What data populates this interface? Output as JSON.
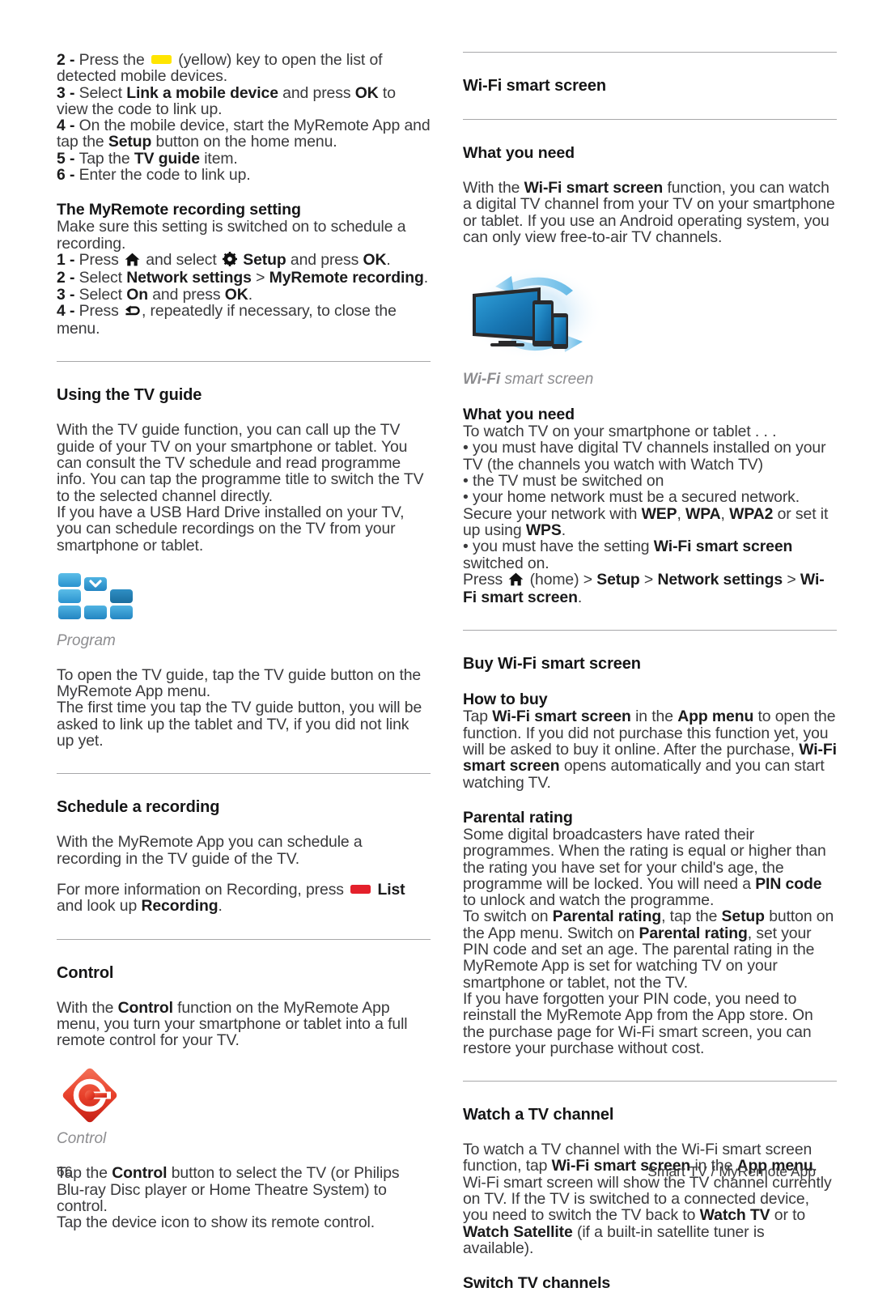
{
  "page": {
    "number": "66",
    "footer_title": "Smart TV / MyRemote App"
  },
  "left_column": {
    "steps_link": [
      {
        "num": "2 -",
        "text_before": "Press the",
        "key": "yellow-key",
        "text_after": "(yellow) key to open the list of detected mobile devices."
      },
      {
        "num": "3 -",
        "text": "Select Link a mobile device and press OK to view the code to link up."
      },
      {
        "num": "4 -",
        "text": "On the mobile device, start the MyRemote App and tap the Setup button on the home menu."
      },
      {
        "num": "5 -",
        "text": "Tap the TV guide item."
      },
      {
        "num": "6 -",
        "text": "Enter the code to link up."
      }
    ],
    "step2_parts": {
      "lead": "Press the",
      "tail": "(yellow) key to open the list of detected mobile devices."
    },
    "step3_parts": {
      "a": "Select ",
      "b1": "Link a mobile device",
      "c": " and press ",
      "b2": "OK",
      "d": " to view the code to link up."
    },
    "step4_parts": {
      "a": "On the mobile device, start the MyRemote App and tap the ",
      "b1": "Setup",
      "c": " button on the home menu."
    },
    "step5_parts": {
      "a": "Tap the ",
      "b1": "TV guide",
      "c": " item."
    },
    "step6_parts": {
      "a": "Enter the code to link up."
    },
    "recording_setting": {
      "heading": "The MyRemote recording setting",
      "intro": "Make sure this setting is switched on to schedule a recording.",
      "step1": {
        "num": "1 -",
        "a": "Press ",
        "icon1": "home-icon",
        "b": " and select ",
        "icon2": "gear-icon",
        "c": " ",
        "bold": "Setup",
        "d": " and press ",
        "bold2": "OK",
        "e": "."
      },
      "step2": {
        "num": "2 -",
        "a": "Select ",
        "b1": "Network settings",
        "c": " > ",
        "b2": "MyRemote recording",
        "d": "."
      },
      "step3": {
        "num": "3 -",
        "a": "Select ",
        "b1": "On",
        "c": " and press ",
        "b2": "OK",
        "d": "."
      },
      "step4": {
        "num": "4 -",
        "a": "Press ",
        "icon": "back-arrow-icon",
        "b": ", repeatedly if necessary, to close the menu."
      }
    },
    "tv_guide": {
      "title": "Using the TV guide",
      "para1": "With the TV guide function, you can call up the TV guide of your TV on your smartphone or tablet. You can consult the TV schedule and read programme info. You can tap the programme title to switch the TV to the selected channel directly.",
      "para2": "If you have a USB Hard Drive installed on your TV, you can schedule recordings on the TV from your smartphone or tablet.",
      "figure_caption": "Program",
      "para3": "To open the TV guide, tap the TV guide button on the MyRemote App menu.",
      "para4": "The first time you tap the TV guide button, you will be asked to link up the tablet and TV, if you did not link up yet."
    },
    "schedule_recording": {
      "title": "Schedule a recording",
      "para1": "With the MyRemote App you can schedule a recording in the TV guide of the TV.",
      "para2_a": "For more information on Recording, press ",
      "para2_key": "red-key",
      "para2_b": "List",
      "para2_c": " and look up ",
      "para2_d": "Recording",
      "para2_e": "."
    },
    "control": {
      "title": "Control",
      "para1_a": "With the ",
      "para1_b": "Control",
      "para1_c": " function on the MyRemote App menu, you turn your smartphone or tablet into a full remote control for your TV.",
      "figure_caption": "Control",
      "para2_a": "Tap the ",
      "para2_b": "Control",
      "para2_c": " button to select the TV (or Philips Blu-ray Disc player or Home Theatre System) to control.",
      "para3": "Tap the device icon to show its remote control."
    }
  },
  "right_column": {
    "wifi_smart_screen": {
      "title": "Wi-Fi smart screen",
      "heading1": "What you need",
      "para1_a": "With the ",
      "para1_b": "Wi-Fi smart screen",
      "para1_c": " function, you can watch a digital TV channel from your TV on your smartphone or tablet. If you use an Android operating system, you can only view free-to-air TV channels.",
      "figure_caption_bold": "Wi-Fi",
      "figure_caption_rest": " smart screen",
      "heading2": "What you need",
      "lead": "To watch TV on your smartphone or tablet . . .",
      "bullets": [
        {
          "text": "you must have digital TV channels installed on your TV (the channels you watch with Watch TV)"
        },
        {
          "text": "the TV must be switched on"
        },
        {
          "text": "your home network must be a secured network. Secure your network with WEP, WPA, WPA2 or set it up using WPS."
        },
        {
          "text": "you must have the setting Wi-Fi smart screen switched on."
        }
      ],
      "bullet3_parts": {
        "a": "your home network must be a secured network. Secure your network with ",
        "b1": "WEP",
        "c": ", ",
        "b2": "WPA",
        "d": ", ",
        "b3": "WPA2",
        "e": " or set it up using ",
        "b4": "WPS",
        "f": "."
      },
      "bullet4_parts": {
        "a": "you must have the setting ",
        "b1": "Wi-Fi smart screen",
        "c": " switched on."
      },
      "press_path": {
        "a": "Press ",
        "icon": "home-icon",
        "b": " (home) > ",
        "b1": "Setup",
        "c": " > ",
        "b2": "Network settings",
        "d": " > ",
        "b3": "Wi-Fi smart screen",
        "e": "."
      }
    },
    "buy": {
      "title": "Buy Wi-Fi smart screen",
      "heading": "How to buy",
      "para_a": "Tap ",
      "para_b1": "Wi-Fi smart screen",
      "para_c": " in the ",
      "para_b2": "App menu",
      "para_d": " to open the function. If you did not purchase this function yet, you will be asked to buy it online. After the purchase, ",
      "para_b3": "Wi-Fi smart screen",
      "para_e": " opens automatically and you can start watching TV."
    },
    "parental": {
      "heading": "Parental rating",
      "p1_a": "Some digital broadcasters have rated their programmes. When the rating is equal or higher than the rating you have set for your child's age, the programme will be locked. You will need a ",
      "p1_b": "PIN code",
      "p1_c": " to unlock and watch the programme.",
      "p2_a": "To switch on ",
      "p2_b1": "Parental rating",
      "p2_c": ", tap the ",
      "p2_b2": "Setup",
      "p2_d": " button on the App menu. Switch on ",
      "p2_b3": "Parental rating",
      "p2_e": ", set your PIN code and set an age. The parental rating in the MyRemote App is set for watching TV on your smartphone or tablet, not the TV.",
      "p3": "If you have forgotten your PIN code, you need to reinstall the MyRemote App from the App store. On the purchase page for Wi-Fi smart screen, you can restore your purchase without cost."
    },
    "watch_channel": {
      "title": "Watch a TV channel",
      "p1_a": "To watch a TV channel with the Wi-Fi smart screen function, tap ",
      "p1_b1": "Wi-Fi smart screen",
      "p1_c": " in the ",
      "p1_b2": "App menu",
      "p1_d": ". Wi-Fi smart screen will show the TV channel currently on TV. If the TV is switched to a connected device, you need to switch the TV back to ",
      "p1_b3": "Watch TV",
      "p1_e": " or to ",
      "p1_b4": "Watch Satellite",
      "p1_f": " (if a built-in satellite tuner is available).",
      "heading_switch": "Switch TV channels"
    }
  },
  "colors": {
    "yellow_key": "#ffe500",
    "red_key": "#e4202b",
    "rule": "#a7a7a9",
    "body_text": "#3a3a3c",
    "heading_text": "#151516",
    "caption_grey": "#8d8d90",
    "program_blue_light": "#3aa7dd",
    "program_blue_dark": "#1b7fb5",
    "control_red": "#e8412b",
    "control_red_dark": "#c81e17",
    "tv_blue": "#1f86c4",
    "glow_blue": "#cfe8f7"
  }
}
